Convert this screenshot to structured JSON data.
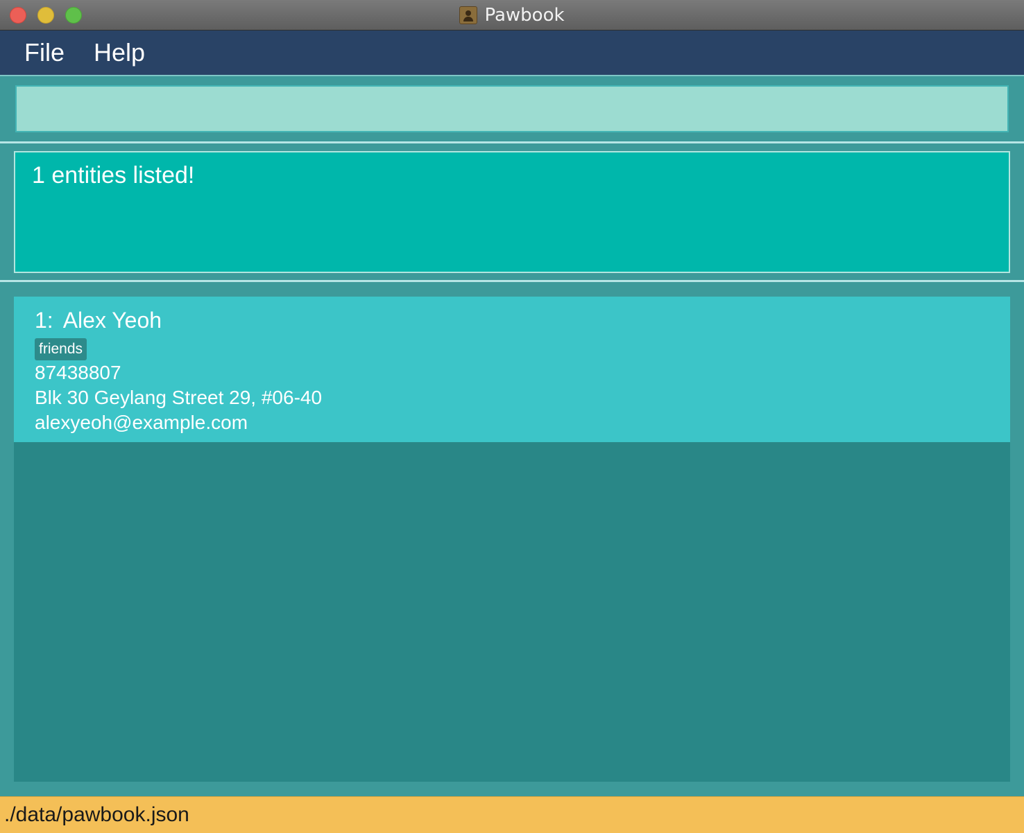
{
  "window": {
    "title": "Pawbook"
  },
  "menu": {
    "items": [
      {
        "label": "File"
      },
      {
        "label": "Help"
      }
    ]
  },
  "command_box": {
    "value": "",
    "placeholder": ""
  },
  "result": {
    "text": "1 entities listed!"
  },
  "list": {
    "cards": [
      {
        "index": "1:",
        "name": "Alex Yeoh",
        "tags": [
          "friends"
        ],
        "phone": "87438807",
        "address": "Blk 30 Geylang Street 29, #06-40",
        "email": "alexyeoh@example.com"
      }
    ]
  },
  "status_bar": {
    "file_path": "./data/pawbook.json"
  },
  "colors": {
    "menubar": "#294366",
    "background": "#3d9a9a",
    "result_box": "#00b7ab",
    "card": "#3cc5c8",
    "list_panel": "#298787",
    "status_bar": "#f4bf57"
  },
  "icons": {
    "app_icon": "address-book-icon",
    "close": "close-traffic-light",
    "minimize": "minimize-traffic-light",
    "maximize": "maximize-traffic-light"
  }
}
